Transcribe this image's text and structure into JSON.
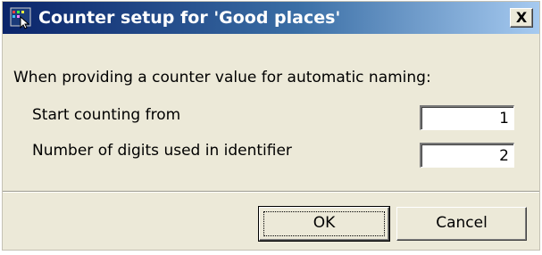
{
  "window": {
    "title": "Counter setup for 'Good places'",
    "close_label": "X",
    "icon": "app-icon"
  },
  "prompt": "When providing a counter value for automatic naming:",
  "fields": [
    {
      "label": "Start counting from",
      "value": "1"
    },
    {
      "label": "Number of digits used in identifier",
      "value": "2"
    }
  ],
  "buttons": {
    "ok_label": "OK",
    "cancel_label": "Cancel"
  },
  "colors": {
    "title_start": "#0a246a",
    "title_end": "#a6caf0",
    "face": "#ece9d8"
  }
}
